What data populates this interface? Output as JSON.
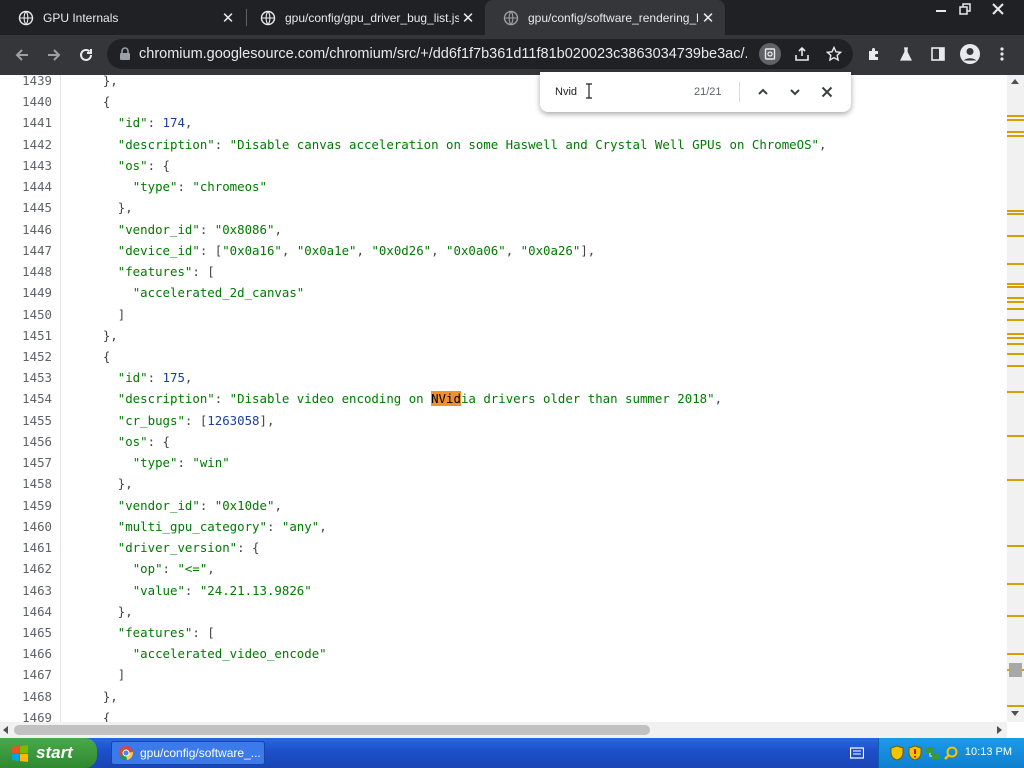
{
  "browser": {
    "tabs": [
      {
        "title": "GPU Internals",
        "active": false
      },
      {
        "title": "gpu/config/gpu_driver_bug_list.json",
        "active": false
      },
      {
        "title": "gpu/config/software_rendering_list",
        "active": true
      }
    ],
    "url": "chromium.googlesource.com/chromium/src/+/dd6f1f7b361d11f81b020023c3863034739be3ac/..."
  },
  "find_bar": {
    "query": "Nvid",
    "count": "21/21"
  },
  "code": {
    "lines": [
      {
        "n": "1439",
        "t": "    },"
      },
      {
        "n": "1440",
        "t": "    {"
      },
      {
        "n": "1441",
        "t": "      \"id\": 174,"
      },
      {
        "n": "1442",
        "t": "      \"description\": \"Disable canvas acceleration on some Haswell and Crystal Well GPUs on ChromeOS\","
      },
      {
        "n": "1443",
        "t": "      \"os\": {"
      },
      {
        "n": "1444",
        "t": "        \"type\": \"chromeos\""
      },
      {
        "n": "1445",
        "t": "      },"
      },
      {
        "n": "1446",
        "t": "      \"vendor_id\": \"0x8086\","
      },
      {
        "n": "1447",
        "t": "      \"device_id\": [\"0x0a16\", \"0x0a1e\", \"0x0d26\", \"0x0a06\", \"0x0a26\"],"
      },
      {
        "n": "1448",
        "t": "      \"features\": ["
      },
      {
        "n": "1449",
        "t": "        \"accelerated_2d_canvas\""
      },
      {
        "n": "1450",
        "t": "      ]"
      },
      {
        "n": "1451",
        "t": "    },"
      },
      {
        "n": "1452",
        "t": "    {"
      },
      {
        "n": "1453",
        "t": "      \"id\": 175,"
      },
      {
        "n": "1454",
        "t": "      \"description\": \"Disable video encoding on NVidia drivers older than summer 2018\","
      },
      {
        "n": "1455",
        "t": "      \"cr_bugs\": [1263058],"
      },
      {
        "n": "1456",
        "t": "      \"os\": {"
      },
      {
        "n": "1457",
        "t": "        \"type\": \"win\""
      },
      {
        "n": "1458",
        "t": "      },"
      },
      {
        "n": "1459",
        "t": "      \"vendor_id\": \"0x10de\","
      },
      {
        "n": "1460",
        "t": "      \"multi_gpu_category\": \"any\","
      },
      {
        "n": "1461",
        "t": "      \"driver_version\": {"
      },
      {
        "n": "1462",
        "t": "        \"op\": \"<=\","
      },
      {
        "n": "1463",
        "t": "        \"value\": \"24.21.13.9826\""
      },
      {
        "n": "1464",
        "t": "      },"
      },
      {
        "n": "1465",
        "t": "      \"features\": ["
      },
      {
        "n": "1466",
        "t": "        \"accelerated_video_encode\""
      },
      {
        "n": "1467",
        "t": "      ]"
      },
      {
        "n": "1468",
        "t": "    },"
      },
      {
        "n": "1469",
        "t": "    {"
      }
    ],
    "highlight": {
      "line": "1454",
      "text": "NVid"
    }
  },
  "taskbar": {
    "start_label": "start",
    "item_label": "gpu/config/software_...",
    "clock": "10:13 PM"
  },
  "colors": {
    "syntax_string": "#007a00",
    "syntax_number": "#1b3f9e",
    "match_highlight": "#f09030",
    "scroll_marks": "#d4a000"
  }
}
